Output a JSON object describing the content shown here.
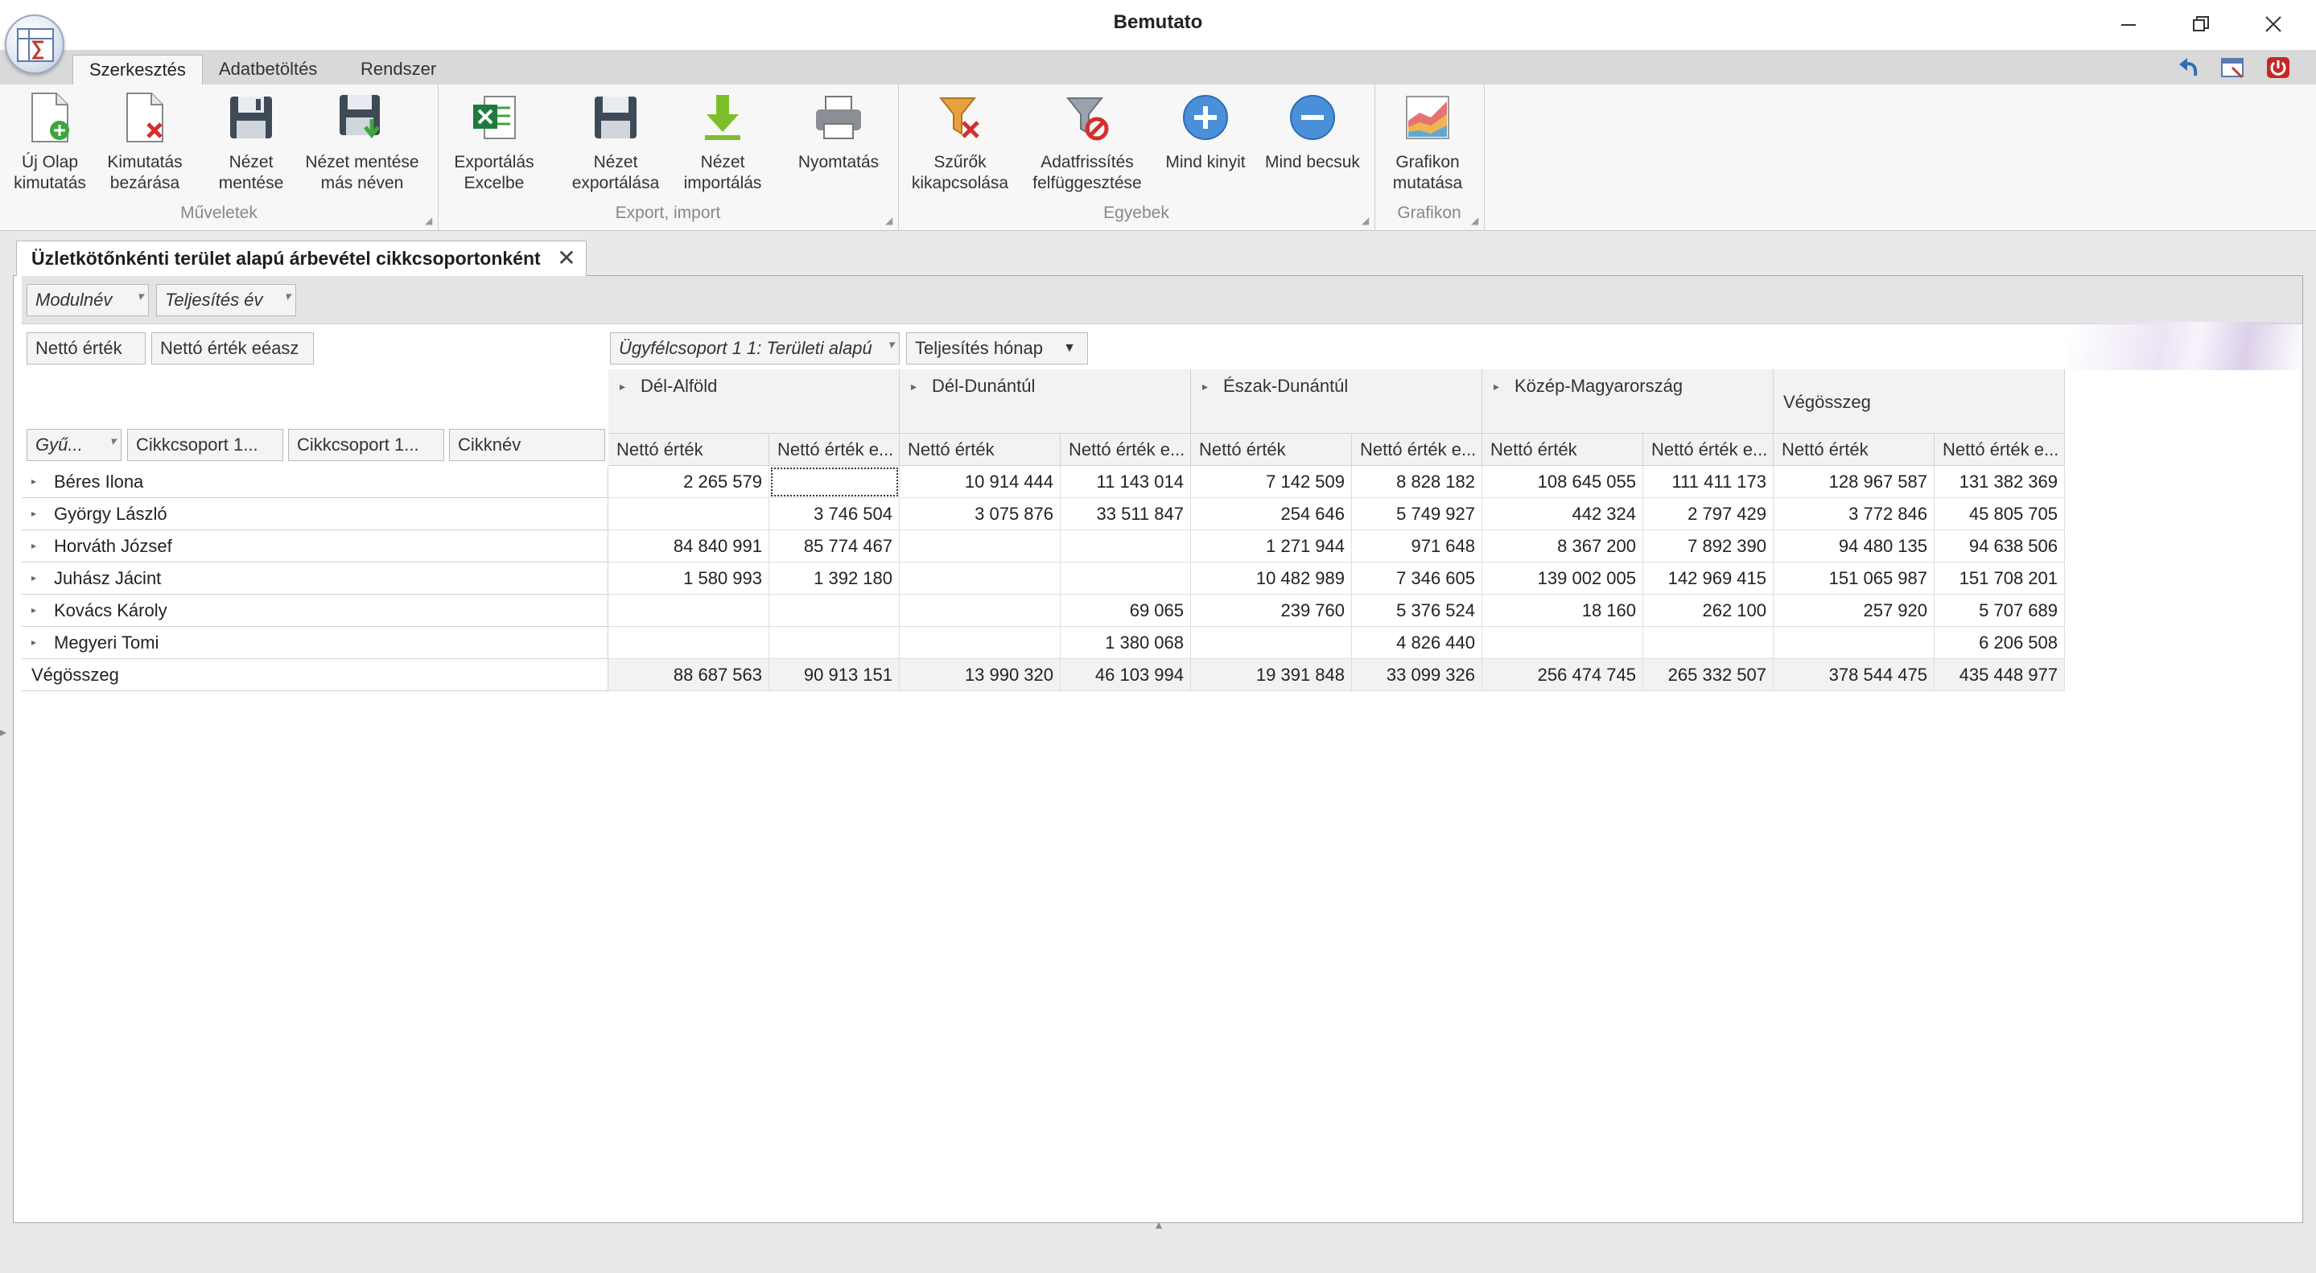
{
  "window": {
    "title": "Bemutato"
  },
  "ribbon": {
    "tabs": [
      "Szerkesztés",
      "Adatbetöltés",
      "Rendszer"
    ],
    "buttons": [
      {
        "label1": "Új Olap",
        "label2": "kimutatás",
        "icon": "new-olap-icon"
      },
      {
        "label1": "Kimutatás",
        "label2": "bezárása",
        "icon": "close-report-icon"
      },
      {
        "label1": "Nézet",
        "label2": "mentése",
        "icon": "save-icon"
      },
      {
        "label1": "Nézet mentése",
        "label2": "más néven",
        "icon": "save-as-icon"
      },
      {
        "label1": "Exportálás",
        "label2": "Excelbe",
        "icon": "excel-icon"
      },
      {
        "label1": "Nézet",
        "label2": "exportálása",
        "icon": "export-view-icon"
      },
      {
        "label1": "Nézet",
        "label2": "importálás",
        "icon": "import-view-icon"
      },
      {
        "label1": "Nyomtatás",
        "label2": "",
        "icon": "print-icon"
      },
      {
        "label1": "Szűrők",
        "label2": "kikapcsolása",
        "icon": "filter-off-icon"
      },
      {
        "label1": "Adatfrissítés",
        "label2": "felfüggesztése",
        "icon": "refresh-suspend-icon"
      },
      {
        "label1": "Mind kinyit",
        "label2": "",
        "icon": "expand-all-icon"
      },
      {
        "label1": "Mind becsuk",
        "label2": "",
        "icon": "collapse-all-icon"
      },
      {
        "label1": "Grafikon",
        "label2": "mutatása",
        "icon": "chart-icon"
      }
    ],
    "groups": [
      "Műveletek",
      "Export, import",
      "Egyebek",
      "Grafikon"
    ]
  },
  "document": {
    "tab_title": "Üzletkötőnkénti terület alapú árbevétel cikkcsoportonként",
    "filter_fields": [
      "Modulnév",
      "Teljesítés év"
    ],
    "data_fields": [
      "Nettó érték",
      "Nettó érték eéasz"
    ],
    "column_fields": [
      "Ügyfélcsoport 1 1: Területi alapú",
      "Teljesítés hónap"
    ],
    "row_fields": [
      "Gyű...",
      "Cikkcsoport 1...",
      "Cikkcsoport 1...",
      "Cikknév"
    ],
    "regions": [
      "Dél-Alföld",
      "Dél-Dunántúl",
      "Észak-Dunántúl",
      "Közép-Magyarország",
      "Végösszeg"
    ],
    "measures": [
      "Nettó érték",
      "Nettó érték e..."
    ],
    "rows": [
      {
        "name": "Béres Ilona",
        "values": [
          "2 265 579",
          "",
          "10 914 444",
          "11 143 014",
          "7 142 509",
          "8 828 182",
          "108 645 055",
          "111 411 173",
          "128 967 587",
          "131 382 369"
        ]
      },
      {
        "name": "György László",
        "values": [
          "",
          "3 746 504",
          "3 075 876",
          "33 511 847",
          "254 646",
          "5 749 927",
          "442 324",
          "2 797 429",
          "3 772 846",
          "45 805 705"
        ]
      },
      {
        "name": "Horváth József",
        "values": [
          "84 840 991",
          "85 774 467",
          "",
          "",
          "1 271 944",
          "971 648",
          "8 367 200",
          "7 892 390",
          "94 480 135",
          "94 638 506"
        ]
      },
      {
        "name": "Juhász Jácint",
        "values": [
          "1 580 993",
          "1 392 180",
          "",
          "",
          "10 482 989",
          "7 346 605",
          "139 002 005",
          "142 969 415",
          "151 065 987",
          "151 708 201"
        ]
      },
      {
        "name": "Kovács Károly",
        "values": [
          "",
          "",
          "",
          "69 065",
          "239 760",
          "5 376 524",
          "18 160",
          "262 100",
          "257 920",
          "5 707 689"
        ]
      },
      {
        "name": "Megyeri Tomi",
        "values": [
          "",
          "",
          "",
          "1 380 068",
          "",
          "4 826 440",
          "",
          "",
          "",
          "6 206 508"
        ]
      }
    ],
    "total": {
      "name": "Végösszeg",
      "values": [
        "88 687 563",
        "90 913 151",
        "13 990 320",
        "46 103 994",
        "19 391 848",
        "33 099 326",
        "256 474 745",
        "265 332 507",
        "378 544 475",
        "435 448 977"
      ]
    }
  }
}
